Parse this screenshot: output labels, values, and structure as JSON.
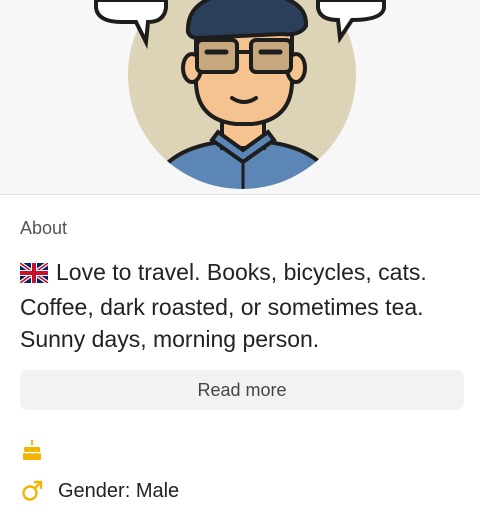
{
  "profile": {
    "avatar_icon": "avatar-illustration"
  },
  "about": {
    "label": "About",
    "bio": "Love to travel. Books, bicycles, cats. Coffee, dark roasted, or sometimes tea. Sunny days, morning person.",
    "flag_icon": "uk-flag-icon",
    "read_more_label": "Read more"
  },
  "details": {
    "birthday_icon": "cake-icon",
    "birthday_value": "",
    "gender_icon": "male-icon",
    "gender_label": "Gender: Male"
  },
  "colors": {
    "accent": "#f5b400",
    "beret": "#2b3e5a",
    "shirt": "#5b86b5",
    "skin": "#f4c38f",
    "avatar_bg": "#ddd3b6"
  }
}
